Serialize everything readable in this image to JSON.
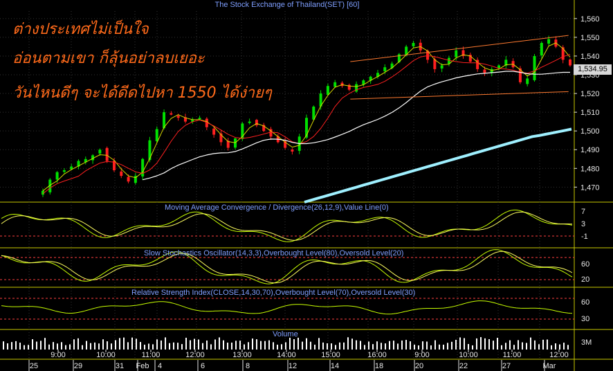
{
  "title": "The Stock Exchange of Thailand(SET) [60]",
  "annotations": [
    "ต่างประเทศไม่เป็นใจ",
    "อ่อนตามเขา ก็ลุ้นอย่าลบเยอะ",
    "วันไหนดีๆ จะได้ดีดไปหา 1550 ได้ง่ายๆ"
  ],
  "last_price_tag": "1,534.95",
  "colors": {
    "background": "#000000",
    "panel_border": "#c8c800",
    "grid": "#333333",
    "candle_up": "#00e000",
    "candle_down": "#ff2020",
    "ma_short": "#d8d800",
    "ma_mid": "#ff2020",
    "ma_long": "#ffffff",
    "ma_200": "#9ff0ff",
    "trend_lines": "#ff7a30",
    "indicator_line": "#c8ff00",
    "signal_line": "#ffff60",
    "level_line": "#ff4040",
    "annotation_text": "#ff6a1a",
    "title_text": "#7f9fff",
    "panel_label_text": "#7f9fff",
    "axis_text": "#e8e8e8",
    "price_tag_bg": "#d8d8d8"
  },
  "panels": {
    "macd_label": "Moving Average Convergence / Divergence(26,12,9),Value Line(0)",
    "stoch_label": "Slow Stochastics Oscillator(14,3,3),Overbought Level(80),Oversold Level(20)",
    "rsi_label": "Relative Strength Index(CLOSE,14,30,70),Overbought Level(70),Oversold Level(30)",
    "volume_label": "Volume"
  },
  "price_axis_ticks": [
    "1,560",
    "1,550",
    "1,540",
    "1,530",
    "1,520",
    "1,510",
    "1,500",
    "1,490",
    "1,480",
    "1,470"
  ],
  "macd_axis_ticks": [
    "7",
    "3",
    "-1"
  ],
  "stoch_axis_ticks": [
    "60",
    "20"
  ],
  "rsi_axis_ticks": [
    "60",
    "30"
  ],
  "volume_axis_ticks": [
    "3M"
  ],
  "time_labels": [
    "9:00",
    "10:00",
    "11:00",
    "12:00",
    "13:00",
    "14:00",
    "15:00",
    "16:00",
    "9:00",
    "10:00",
    "11:00",
    "12:00"
  ],
  "date_labels": [
    "25",
    "29",
    "31",
    "Feb",
    "4",
    "6",
    "8",
    "12",
    "14",
    "18",
    "20",
    "22",
    "27",
    "Mar"
  ],
  "chart_data": {
    "type": "candlestick",
    "series": [
      {
        "name": "price",
        "close": [
          1468,
          1474,
          1478,
          1479,
          1481,
          1484,
          1485,
          1487,
          1490,
          1484,
          1479,
          1476,
          1473,
          1476,
          1485,
          1495,
          1501,
          1510,
          1509,
          1507,
          1505,
          1506,
          1507,
          1502,
          1498,
          1494,
          1491,
          1496,
          1504,
          1505,
          1503,
          1500,
          1497,
          1494,
          1491,
          1489,
          1497,
          1507,
          1513,
          1520,
          1524,
          1526,
          1524,
          1522,
          1525,
          1527,
          1529,
          1531,
          1534,
          1536,
          1541,
          1545,
          1547,
          1543,
          1538,
          1533,
          1535,
          1539,
          1543,
          1540,
          1537,
          1533,
          1531,
          1533,
          1535,
          1538,
          1534,
          1526,
          1528,
          1540,
          1547,
          1549,
          1545,
          1538,
          1535
        ]
      },
      {
        "name": "ma_200",
        "values": [
          1462,
          1463,
          1464,
          1465,
          1466,
          1467,
          1468,
          1469,
          1470,
          1471,
          1472,
          1473,
          1474,
          1475,
          1476,
          1477,
          1478,
          1479,
          1480,
          1481,
          1482,
          1483,
          1484,
          1485,
          1486,
          1487,
          1488,
          1489,
          1490,
          1491,
          1492,
          1493,
          1494,
          1495,
          1496,
          1497,
          1497.5,
          1498.2,
          1498.9,
          1499.6,
          1500.3,
          1501
        ]
      }
    ],
    "trend_lines": [
      {
        "from": [
          1537,
          0.61
        ],
        "to": [
          1551,
          0.99
        ]
      },
      {
        "from": [
          1517,
          0.61
        ],
        "to": [
          1521,
          0.99
        ]
      }
    ],
    "ylim": [
      1462,
      1564
    ]
  }
}
